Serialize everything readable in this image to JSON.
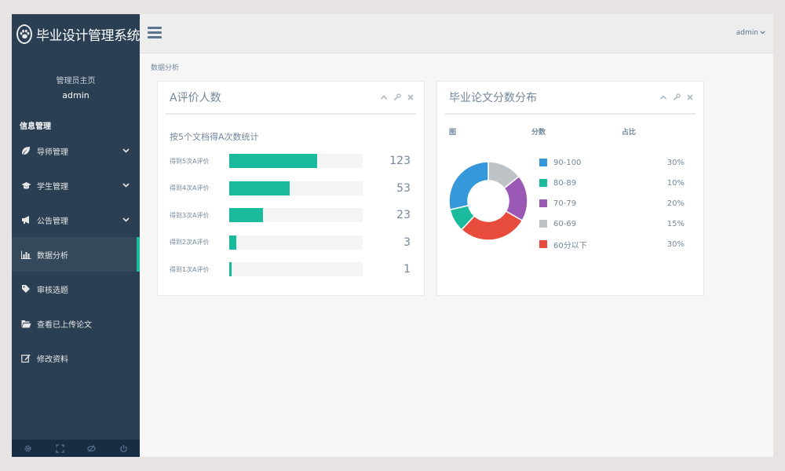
{
  "app": {
    "title": "毕业设计管理系统"
  },
  "profile": {
    "role": "管理员主页",
    "name": "admin"
  },
  "sidebar": {
    "section_title": "信息管理",
    "items": [
      {
        "label": "导师管理",
        "icon": "leaf-icon",
        "has_caret": true
      },
      {
        "label": "学生管理",
        "icon": "graduation-cap-icon",
        "has_caret": true
      },
      {
        "label": "公告管理",
        "icon": "bullhorn-icon",
        "has_caret": true
      },
      {
        "label": "数据分析",
        "icon": "bar-chart-icon",
        "has_caret": false,
        "active": true
      },
      {
        "label": "审核选题",
        "icon": "tag-icon",
        "has_caret": false
      },
      {
        "label": "查看已上传论文",
        "icon": "folder-open-icon",
        "has_caret": false
      },
      {
        "label": "修改资料",
        "icon": "edit-icon",
        "has_caret": false
      }
    ],
    "footer_icons": [
      "gear-icon",
      "fullscreen-icon",
      "eye-slash-icon",
      "power-icon"
    ]
  },
  "topbar": {
    "user": "admin"
  },
  "breadcrumb": "数据分析",
  "panel_a": {
    "title": "A评价人数",
    "subtitle": "按5个文档得A次数统计",
    "rows": [
      {
        "label": "得到5次A评价",
        "value": "123",
        "fill": 0.66
      },
      {
        "label": "得到4次A评价",
        "value": "53",
        "fill": 0.45
      },
      {
        "label": "得到3次A评价",
        "value": "23",
        "fill": 0.25
      },
      {
        "label": "得到2次A评价",
        "value": "3",
        "fill": 0.05
      },
      {
        "label": "得到1次A评价",
        "value": "1",
        "fill": 0.02
      }
    ]
  },
  "panel_b": {
    "title": "毕业论文分数分布",
    "col_chart": "图",
    "col_score": "分数",
    "col_ratio": "占比"
  },
  "chart_data": {
    "type": "pie",
    "categories": [
      "90-100",
      "80-89",
      "70-79",
      "60-69",
      "60分以下"
    ],
    "values": [
      30,
      10,
      20,
      15,
      30
    ],
    "labels": [
      "30%",
      "10%",
      "20%",
      "15%",
      "30%"
    ],
    "colors": [
      "#3498db",
      "#1abb9c",
      "#9b59b6",
      "#bdc3c7",
      "#e74c3c"
    ]
  },
  "colors": {
    "sidebar": "#2a3f54",
    "accent": "#1abb9c"
  }
}
